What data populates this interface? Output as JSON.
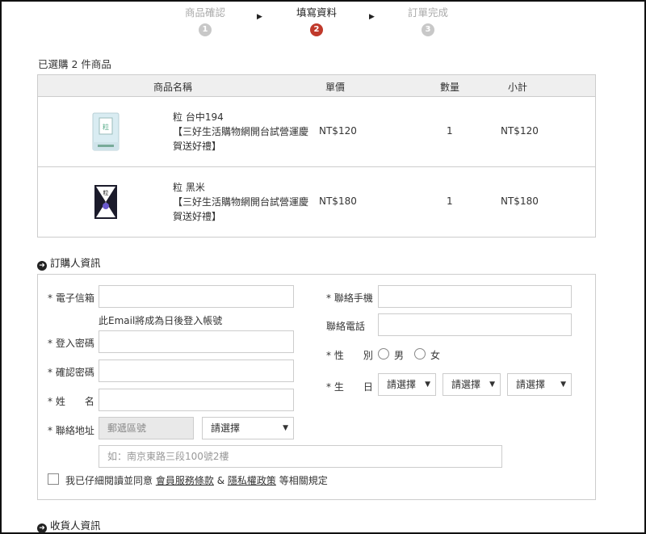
{
  "steps": [
    {
      "label": "商品確認",
      "num": "1"
    },
    {
      "label": "填寫資料",
      "num": "2"
    },
    {
      "label": "訂單完成",
      "num": "3"
    }
  ],
  "summary": "已選購 2 件商品",
  "table": {
    "headers": {
      "name": "商品名稱",
      "price": "單價",
      "qty": "數量",
      "subtotal": "小計"
    },
    "rows": [
      {
        "line1": "粒 台中194",
        "line2": "【三好生活購物網開台試營運慶",
        "line3": "賀送好禮】",
        "price": "NT$120",
        "qty": "1",
        "subtotal": "NT$120"
      },
      {
        "line1": "粒 黑米",
        "line2": "【三好生活購物網開台試營運慶",
        "line3": "賀送好禮】",
        "price": "NT$180",
        "qty": "1",
        "subtotal": "NT$180"
      }
    ]
  },
  "buyer_section": "訂購人資訊",
  "receiver_section": "收貨人資訊",
  "form": {
    "email_label": "* 電子信箱",
    "email_hint": "此Email將成為日後登入帳號",
    "password_label": "* 登入密碼",
    "confirm_label": "* 確認密碼",
    "name_label": "* 姓　　名",
    "address_label": "* 聯絡地址",
    "zip_placeholder": "郵遞區號",
    "city_select": "請選擇",
    "address_placeholder": "如：南京東路三段100號2樓",
    "mobile_label": "* 聯絡手機",
    "phone_label": "聯絡電話",
    "gender_label": "* 性　　別",
    "male": "男",
    "female": "女",
    "birthday_label": "* 生　　日",
    "year_select": "請選擇",
    "month_select": "請選擇",
    "day_select": "請選擇",
    "agree_prefix": "我已仔細閱讀並同意",
    "terms_link": "會員服務條款",
    "amp": "&",
    "privacy_link": "隱私權政策",
    "agree_suffix": "等相關規定"
  }
}
